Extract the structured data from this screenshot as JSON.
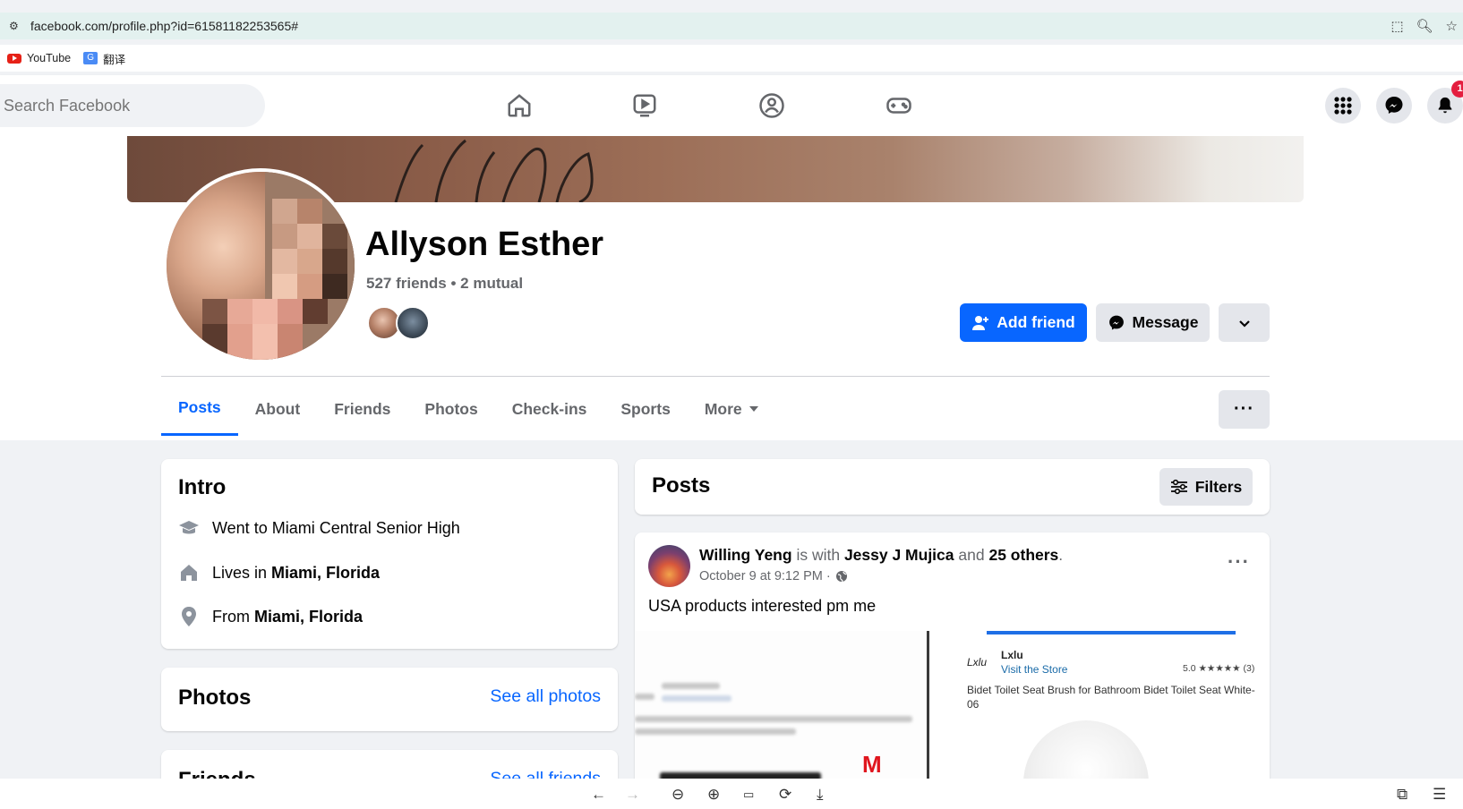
{
  "browser": {
    "url": "facebook.com/profile.php?id=61581182253565#",
    "bookmarks": [
      {
        "label": "YouTube",
        "icon": "youtube-icon"
      },
      {
        "label": "翻译",
        "icon": "translate-icon"
      }
    ]
  },
  "fb": {
    "search_placeholder": "Search Facebook",
    "notification_count": "1"
  },
  "profile": {
    "name": "Allyson Esther",
    "friends_line": "527 friends • 2 mutual",
    "add_friend_label": "Add friend",
    "message_label": "Message"
  },
  "tabs": [
    "Posts",
    "About",
    "Friends",
    "Photos",
    "Check-ins",
    "Sports",
    "More"
  ],
  "intro": {
    "title": "Intro",
    "school": "Went to Miami Central Senior High",
    "lives_prefix": "Lives in",
    "lives_place": "Miami, Florida",
    "from_prefix": "From",
    "from_place": "Miami, Florida"
  },
  "photos": {
    "title": "Photos",
    "see_all": "See all photos"
  },
  "friends": {
    "title": "Friends",
    "see_all": "See all friends"
  },
  "posts": {
    "title": "Posts",
    "filters_label": "Filters",
    "post": {
      "author": "Willing Yeng",
      "is_with": "is with",
      "tagged": "Jessy J Mujica",
      "and": "and",
      "others": "25 others",
      "time": "October 9 at 9:12 PM ·",
      "text": "USA products interested pm me",
      "product": {
        "store_logo": "Lxlu",
        "store_name": "Lxlu",
        "visit_store": "Visit the Store",
        "rating": "5.0 ★★★★★ (3)",
        "title": "Bidet Toilet Seat Brush for Bathroom Bidet Toilet Seat White-06",
        "left_badge": "M"
      }
    }
  },
  "colors": {
    "fb_blue": "#0866ff",
    "bg": "#f0f2f5",
    "secondary_button": "#e4e6eb",
    "muted_text": "#65676b"
  }
}
